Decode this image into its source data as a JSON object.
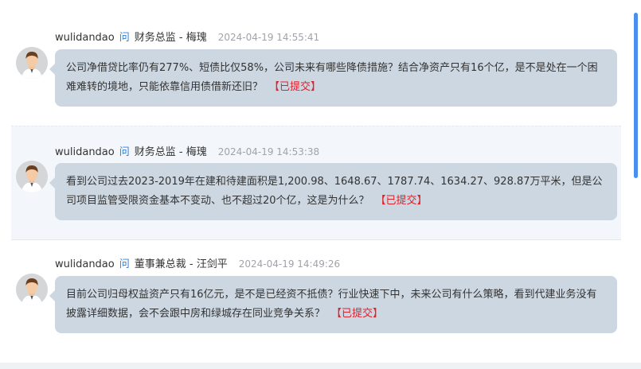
{
  "questions": [
    {
      "user": "wulidandao",
      "ask_marker": "问",
      "target": "财务总监 - 梅瑰",
      "time": "2024-04-19 14:55:41",
      "question": "公司净借贷比率仍有277%、短债比仅58%，公司未来有哪些降债措施？结合净资产只有16个亿，是不是处在一个困难难转的境地，只能依靠信用债借新还旧？",
      "status": "【已提交】"
    },
    {
      "user": "wulidandao",
      "ask_marker": "问",
      "target": "财务总监 - 梅瑰",
      "time": "2024-04-19 14:53:38",
      "question": "看到公司过去2023-2019年在建和待建面积是1,200.98、1648.67、1787.74、1634.27、928.87万平米，但是公司项目监管受限资金基本不变动、也不超过20个亿，这是为什么？",
      "status": "【已提交】"
    },
    {
      "user": "wulidandao",
      "ask_marker": "问",
      "target": "董事兼总裁 - 汪剑平",
      "time": "2024-04-19 14:49:26",
      "question": "目前公司归母权益资产只有16亿元，是不是已经资不抵债？行业快速下中，未来公司有什么策略，看到代建业务没有披露详细数据，会不会跟中房和绿城存在同业竞争关系？",
      "status": "【已提交】"
    }
  ],
  "colors": {
    "bubble": "#cdd7e1",
    "ask_marker": "#2f7fd8",
    "status": "#e0202a",
    "highlight_bg": "#f3f6fa",
    "scroll_thumb": "#4a8ef0"
  },
  "icons": {
    "avatar": "user-avatar-icon"
  }
}
